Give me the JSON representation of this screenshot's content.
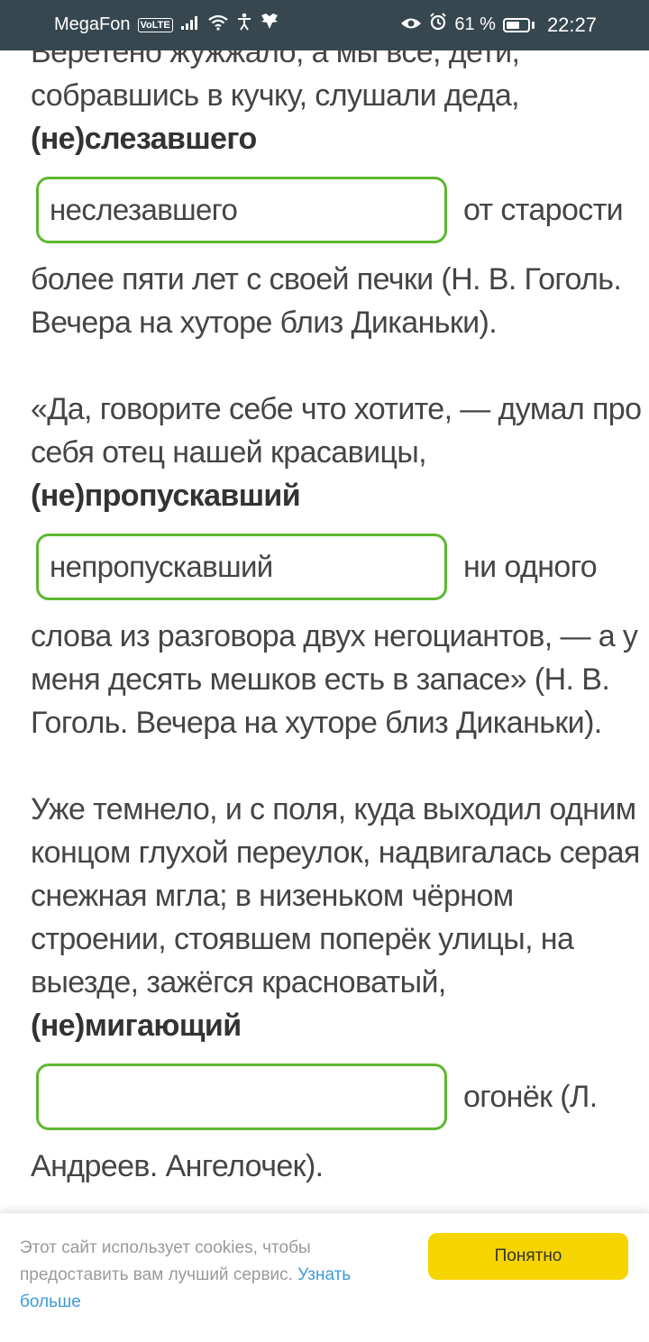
{
  "status_bar": {
    "carrier": "MegaFon",
    "volte": "VoLTE",
    "battery": "61 %",
    "time": "22:27",
    "icons": [
      "signal-icon",
      "wifi-icon",
      "accessibility-icon",
      "eagle-icon",
      "eye-icon",
      "alarm-icon",
      "battery-icon"
    ]
  },
  "text": {
    "p1_line0": "Веретено жужжало, а мы все, дети,",
    "p1_line1": "собравшись в кучку, слушали деда,",
    "p1_word": "(не)слезавшего",
    "p1_answer": "неслезавшего",
    "p1_after": "от старости",
    "p1_line2": "более пяти лет с своей печки (Н. В. Гоголь.",
    "p1_line3": "Вечера на хуторе близ Диканьки).",
    "p2_line1": "«Да, говорите себе что хотите, — думал про",
    "p2_line2": "себя отец нашей красавицы,",
    "p2_word": "(не)пропускавший",
    "p2_answer": "непропускавший",
    "p2_after": "ни одного",
    "p2_line3": "слова из разговора двух негоциантов, — а у",
    "p2_line4": "меня десять мешков есть в запасе» (Н. В.",
    "p2_line5": "Гоголь. Вечера на хуторе близ Диканьки).",
    "p3_line1": "Уже темнело, и с поля, куда выходил одним",
    "p3_line2": "концом глухой переулок, надвигалась серая",
    "p3_line3": "снежная мгла; в низеньком чёрном",
    "p3_line4": "строении, стоявшем поперёк улицы, на",
    "p3_line5": "выезде, зажёгся красноватый,",
    "p3_word": "(не)мигающий",
    "p3_answer": "",
    "p3_after": "огонёк (Л.",
    "p3_line6": "Андреев. Ангелочек)."
  },
  "cookie": {
    "text": "Этот сайт использует cookies, чтобы предоставить вам лучший сервис.",
    "link": "Узнать больше",
    "button": "Понятно"
  },
  "colors": {
    "status_bar": "#37474f",
    "input_border": "#5cb82f",
    "button": "#f5d400",
    "link": "#3b9bd8"
  }
}
